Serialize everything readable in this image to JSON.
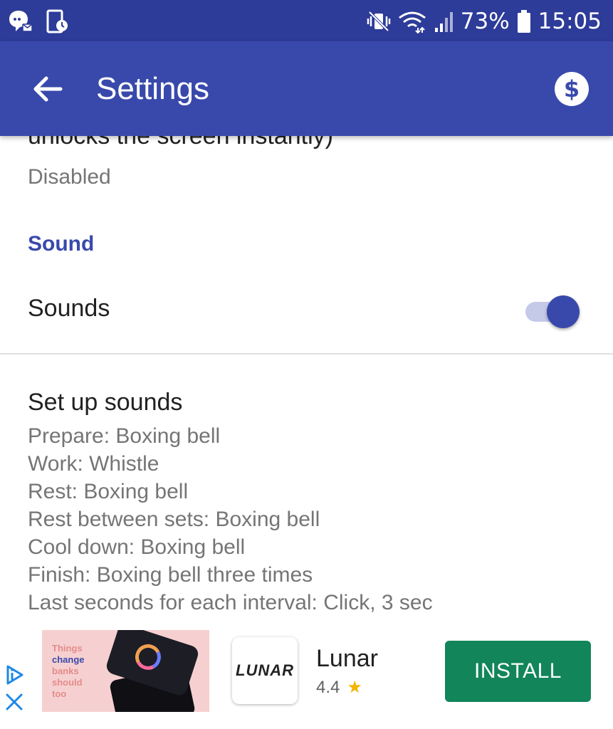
{
  "status_bar": {
    "left_icons": [
      "chat-notification-icon",
      "screen-timer-icon"
    ],
    "right_icons": [
      "vibrate-mute-icon",
      "wifi-icon",
      "signal-icon",
      "battery-icon"
    ],
    "battery": "73%",
    "time": "15:05"
  },
  "app_bar": {
    "title": "Settings",
    "back_icon": "arrow-back-icon",
    "action_icon": "dollar-icon"
  },
  "content": {
    "clipped_title": "unlocks the screen instantly)",
    "clipped_summary": "Disabled",
    "section_header": "Sound",
    "sounds_toggle": {
      "label": "Sounds",
      "checked": true
    },
    "setup_sounds": {
      "title": "Set up sounds",
      "lines": [
        "Prepare: Boxing bell",
        "Work: Whistle",
        "Rest: Boxing bell",
        "Rest between sets: Boxing bell",
        "Cool down: Boxing bell",
        "Finish: Boxing bell three times",
        "Last seconds for each interval: Click, 3 sec"
      ]
    }
  },
  "ad": {
    "image_text": [
      "Things",
      "change",
      "banks",
      "should",
      "too"
    ],
    "logo_text": "LUNAR",
    "app_name": "Lunar",
    "rating": "4.4",
    "install_label": "INSTALL",
    "colors": {
      "install": "#12855b",
      "header": "#3949ab",
      "status": "#2d3b99"
    }
  }
}
